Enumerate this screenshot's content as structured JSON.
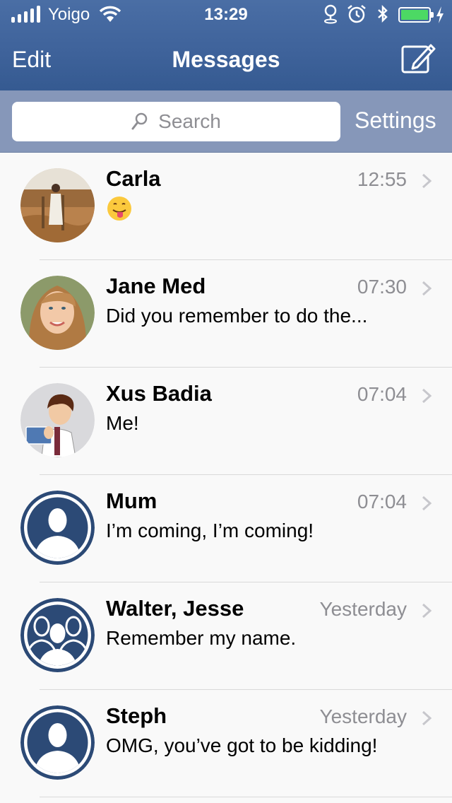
{
  "status_bar": {
    "carrier": "Yoigo",
    "time": "13:29",
    "icons": [
      "signal-icon",
      "wifi-icon",
      "location-icon",
      "alarm-icon",
      "bluetooth-icon",
      "battery-icon",
      "charging-icon"
    ]
  },
  "nav": {
    "edit_label": "Edit",
    "title": "Messages",
    "compose_icon": "compose-icon"
  },
  "search": {
    "placeholder": "Search",
    "settings_label": "Settings"
  },
  "conversations": [
    {
      "name": "Carla",
      "time": "12:55",
      "preview": "",
      "preview_emoji": "tongue-out-emoji",
      "avatar": "photo-landscape-woman"
    },
    {
      "name": "Jane Med",
      "time": "07:30",
      "preview": "Did you remember to do the...",
      "avatar": "photo-portrait-woman"
    },
    {
      "name": "Xus Badia",
      "time": "07:04",
      "preview": "Me!",
      "avatar": "cartoon-man-holding-card"
    },
    {
      "name": "Mum",
      "time": "07:04",
      "preview": "I’m coming, I’m coming!",
      "avatar": "default-person-icon"
    },
    {
      "name": "Walter, Jesse",
      "time": "Yesterday",
      "preview": "Remember my name.",
      "avatar": "default-group-icon"
    },
    {
      "name": "Steph",
      "time": "Yesterday",
      "preview": "OMG, you’ve got to be kidding!",
      "avatar": "default-person-icon"
    }
  ],
  "colors": {
    "nav_bar": "#3f639b",
    "search_bar": "#8697b9",
    "avatar_ring": "#2c4a76",
    "timestamp": "#8e8e93",
    "battery": "#4cd964"
  }
}
